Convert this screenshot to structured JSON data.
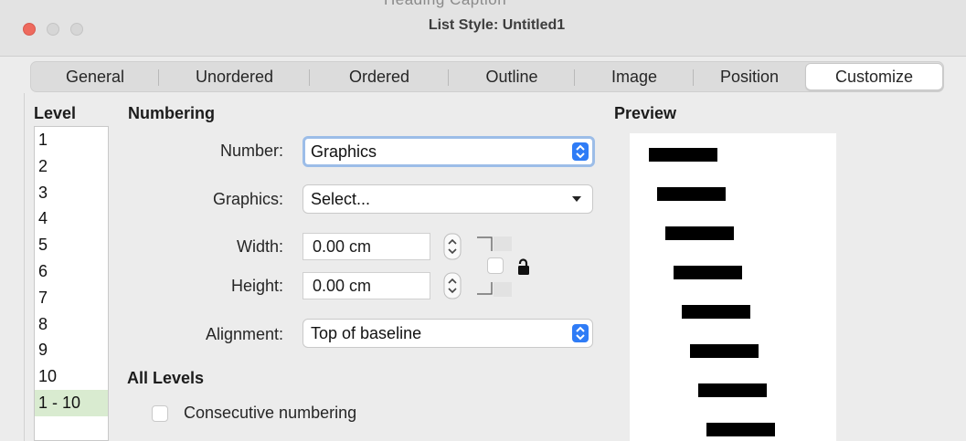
{
  "window": {
    "title": "List Style: Untitled1",
    "background_text": "Heading Caption"
  },
  "tabs": [
    {
      "label": "General"
    },
    {
      "label": "Unordered"
    },
    {
      "label": "Ordered"
    },
    {
      "label": "Outline"
    },
    {
      "label": "Image"
    },
    {
      "label": "Position"
    },
    {
      "label": "Customize",
      "active": true
    }
  ],
  "level": {
    "heading": "Level",
    "items": [
      "1",
      "2",
      "3",
      "4",
      "5",
      "6",
      "7",
      "8",
      "9",
      "10",
      "1 - 10"
    ],
    "selected": "1 - 10"
  },
  "numbering": {
    "heading": "Numbering",
    "number": {
      "label": "Number:",
      "value": "Graphics"
    },
    "graphics": {
      "label": "Graphics:",
      "value": "Select..."
    },
    "width": {
      "label": "Width:",
      "value": "0.00 cm"
    },
    "height": {
      "label": "Height:",
      "value": "0.00 cm"
    },
    "alignment": {
      "label": "Alignment:",
      "value": "Top of baseline"
    }
  },
  "all_levels": {
    "heading": "All Levels",
    "consecutive": {
      "label": "Consecutive numbering",
      "checked": false
    }
  },
  "preview": {
    "heading": "Preview",
    "levels_shown": 8
  },
  "colors": {
    "accent": "#2f7cf6",
    "selection": "#d9ebd0",
    "close": "#ee6a5e"
  }
}
